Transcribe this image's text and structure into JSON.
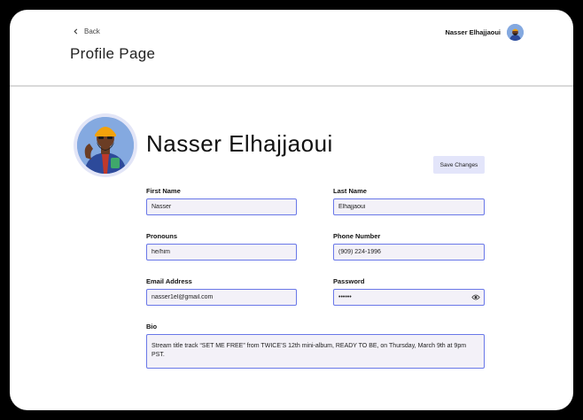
{
  "header": {
    "back_label": "Back",
    "page_title": "Profile Page",
    "user_name": "Nasser Elhajjaoui"
  },
  "profile": {
    "name": "Nasser Elhajjaoui",
    "save_label": "Save Changes"
  },
  "form": {
    "first_name": {
      "label": "First Name",
      "value": "Nasser"
    },
    "last_name": {
      "label": "Last Name",
      "value": "Elhajjaoui"
    },
    "pronouns": {
      "label": "Pronouns",
      "value": "he/him"
    },
    "phone": {
      "label": "Phone Number",
      "value": "(909) 224-1996"
    },
    "email": {
      "label": "Email Address",
      "value": "nasser1el@gmail.com"
    },
    "password": {
      "label": "Password",
      "value": "••••••"
    },
    "bio": {
      "label": "Bio",
      "value": "Stream title track “SET ME FREE” from TWICE’S 12th mini-album, READY TO BE, on Thursday, March 9th at 9pm PST."
    }
  },
  "colors": {
    "accent": "#6a78e8",
    "button_bg": "#e3e5fa",
    "field_bg": "#f3f1f8"
  }
}
